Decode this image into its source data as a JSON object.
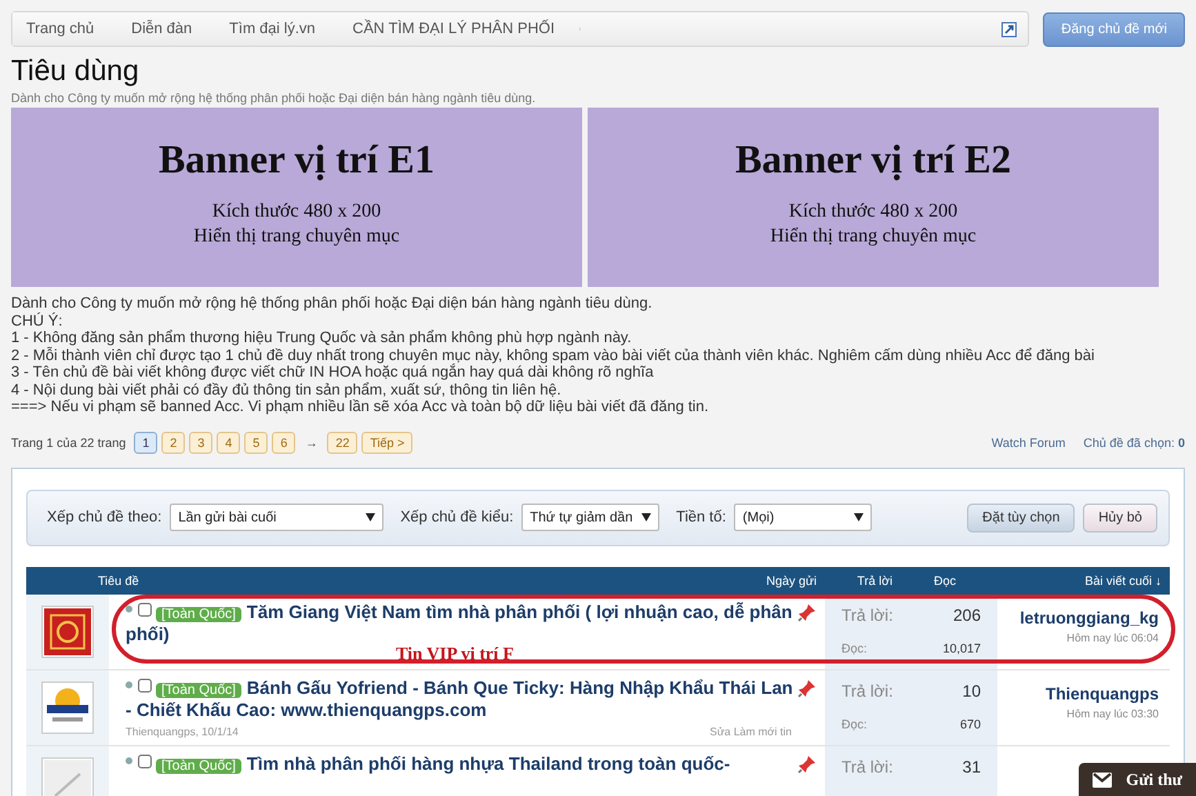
{
  "breadcrumbs": [
    "Trang chủ",
    "Diễn đàn",
    "Tìm đại lý.vn",
    "CẦN TÌM ĐẠI LÝ PHÂN PHỐI"
  ],
  "new_thread_button": "Đăng chủ đề mới",
  "title": "Tiêu dùng",
  "description": "Dành cho Công ty muốn mở rộng hệ thống phân phối hoặc Đại diện bán hàng ngành tiêu dùng.",
  "banners": [
    {
      "heading": "Banner vị trí E1",
      "size": "Kích thước 480 x 200",
      "note": "Hiển thị trang chuyên mục"
    },
    {
      "heading": "Banner vị trí E2",
      "size": "Kích thước 480 x 200",
      "note": "Hiển thị trang chuyên mục"
    }
  ],
  "rules": [
    "Dành cho Công ty muốn mở rộng hệ thống phân phối hoặc Đại diện bán hàng ngành tiêu dùng.",
    "CHÚ Ý:",
    "1 - Không đăng sản phẩm thương hiệu Trung Quốc và sản phẩm không phù hợp ngành này.",
    "2 - Mỗi thành viên chỉ được tạo 1 chủ đề duy nhất trong chuyên mục này, không spam vào bài viết của thành viên khác. Nghiêm cấm dùng nhiều Acc để đăng bài",
    "3 - Tên chủ đề bài viết không được viết chữ IN HOA hoặc quá ngắn hay quá dài không rõ nghĩa",
    "4 - Nội dung bài viết phải có đầy đủ thông tin sản phẩm, xuất sứ, thông tin liên hệ.",
    "===> Nếu vi phạm sẽ banned Acc. Vi phạm nhiều lần sẽ xóa Acc và toàn bộ dữ liệu bài viết đã đăng tin."
  ],
  "pagination": {
    "label": "Trang 1 của 22 trang",
    "pages": [
      {
        "label": "1",
        "selected": true
      },
      {
        "label": "2",
        "selected": false
      },
      {
        "label": "3",
        "selected": false
      },
      {
        "label": "4",
        "selected": false
      },
      {
        "label": "5",
        "selected": false
      },
      {
        "label": "6",
        "selected": false
      },
      {
        "label": "→",
        "kind": "gap"
      },
      {
        "label": "22",
        "selected": false
      },
      {
        "label": "Tiếp >",
        "selected": false
      }
    ]
  },
  "watch_forum": "Watch Forum",
  "selected_count": {
    "label": "Chủ đề đã chọn:",
    "value": "0"
  },
  "filters": [
    {
      "label": "Xếp chủ đề theo:",
      "value": "Lần gửi bài cuối"
    },
    {
      "label": "Xếp chủ đề kiểu:",
      "value": "Thứ tự giảm dần"
    },
    {
      "label": "Tiền tố:",
      "value": "(Mọi)"
    }
  ],
  "filter_buttons": [
    "Đặt tùy chọn",
    "Hủy bỏ"
  ],
  "table": {
    "columns": [
      "Tiêu đề",
      "Ngày gửi",
      "Trả lời",
      "Đọc",
      "Bài viết cuối ↓"
    ],
    "rows": [
      {
        "prefix": "[Toàn Quốc]",
        "title": "Tăm Giang Việt Nam tìm nhà phân phối ( lợi nhuận cao, dễ phân phối)",
        "meta": "",
        "actions": "",
        "replies_label": "Trả lời:",
        "replies": "206",
        "views_label": "Đọc:",
        "views": "10,017",
        "last_user": "letruonggiang_kg",
        "last_time": "Hôm nay lúc 06:04",
        "highlight": "Tin VIP vị trí F",
        "checked": false
      },
      {
        "prefix": "[Toàn Quốc]",
        "title": "Bánh Gấu Yofriend - Bánh Que Ticky: Hàng Nhập Khẩu Thái Lan - Chiết Khấu Cao: www.thienquangps.com",
        "meta": "Thienquangps, 10/1/14",
        "actions": "Sửa Làm mới tin",
        "replies_label": "Trả lời:",
        "replies": "10",
        "views_label": "Đọc:",
        "views": "670",
        "last_user": "Thienquangps",
        "last_time": "Hôm nay lúc 03:30",
        "highlight": "",
        "checked": false
      },
      {
        "prefix": "[Toàn Quốc]",
        "title": "Tìm nhà phân phối hàng nhựa Thailand trong toàn quốc-",
        "meta": "",
        "actions": "",
        "replies_label": "Trả lời:",
        "replies": "31",
        "views_label": "",
        "views": "",
        "last_user": "",
        "last_time": "",
        "highlight": "",
        "checked": false
      }
    ]
  },
  "send_mail_button": "Gửi thư"
}
